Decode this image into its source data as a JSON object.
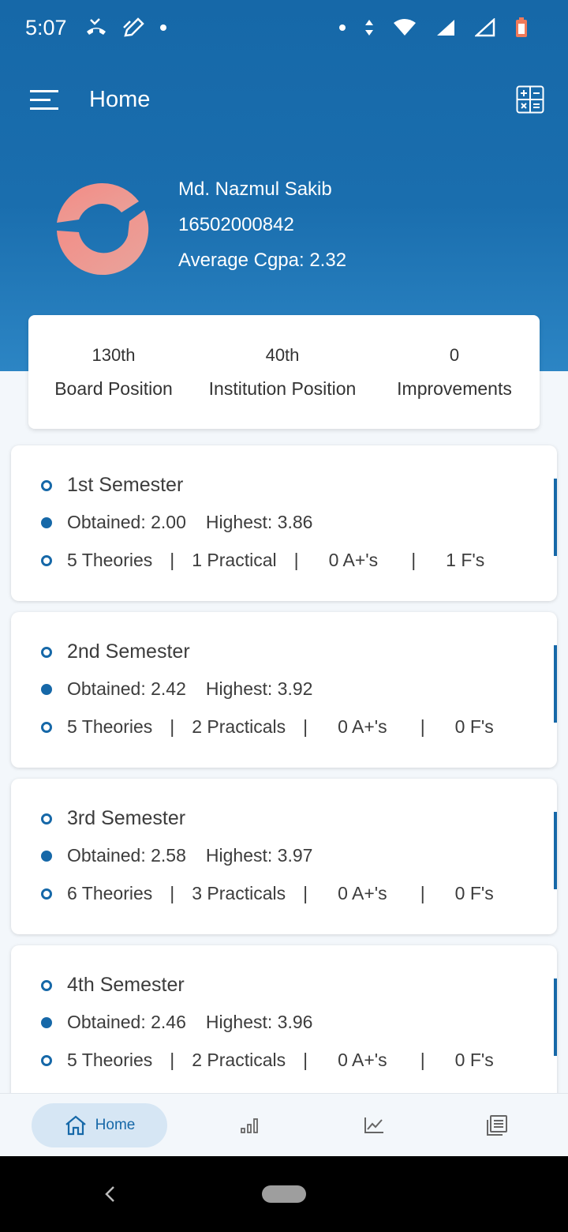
{
  "status": {
    "time": "5:07"
  },
  "appbar": {
    "title": "Home"
  },
  "profile": {
    "name": "Md. Nazmul Sakib",
    "id": "16502000842",
    "cgpa": "Average Cgpa: 2.32"
  },
  "stats": [
    {
      "value": "130th",
      "label": "Board Position"
    },
    {
      "value": "40th",
      "label": "Institution Position"
    },
    {
      "value": "0",
      "label": "Improvements"
    }
  ],
  "semesters": [
    {
      "title": "1st Semester",
      "obtained": "Obtained: 2.00",
      "highest": "Highest: 3.86",
      "theories": "5 Theories",
      "practicals": "1 Practical",
      "aplus": "0 A+'s",
      "fails": "1 F's"
    },
    {
      "title": "2nd Semester",
      "obtained": "Obtained: 2.42",
      "highest": "Highest: 3.92",
      "theories": "5 Theories",
      "practicals": "2 Practicals",
      "aplus": "0 A+'s",
      "fails": "0 F's"
    },
    {
      "title": "3rd Semester",
      "obtained": "Obtained: 2.58",
      "highest": "Highest: 3.97",
      "theories": "6 Theories",
      "practicals": "3 Practicals",
      "aplus": "0 A+'s",
      "fails": "0 F's"
    },
    {
      "title": "4th Semester",
      "obtained": "Obtained: 2.46",
      "highest": "Highest: 3.96",
      "theories": "5 Theories",
      "practicals": "2 Practicals",
      "aplus": "0 A+'s",
      "fails": "0 F's"
    }
  ],
  "separator": "|",
  "bottom_nav": {
    "home_label": "Home"
  },
  "colors": {
    "primary": "#1668a8",
    "logo": "#ef8f8a",
    "active_nav_bg": "#d6e6f4"
  }
}
